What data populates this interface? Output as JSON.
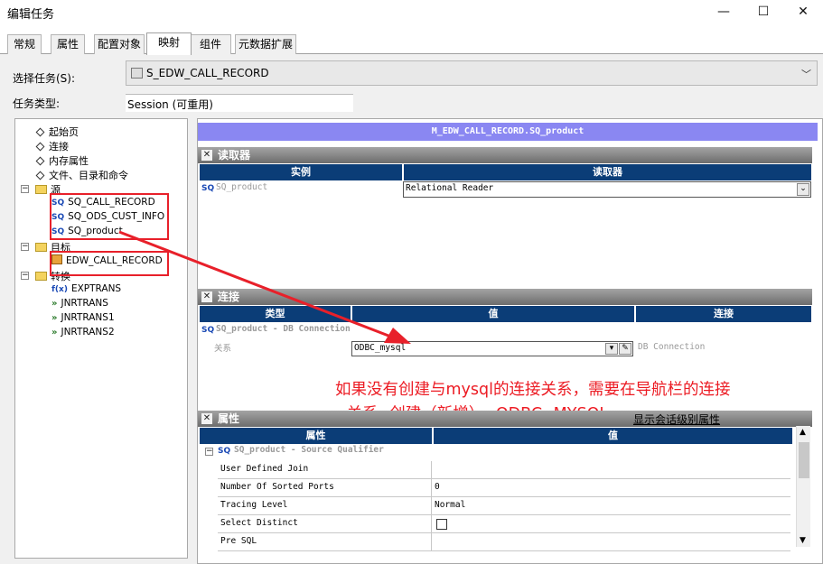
{
  "window": {
    "title": "编辑任务",
    "min": "—",
    "max": "☐",
    "close": "✕"
  },
  "tabs": [
    "常规",
    "属性",
    "配置对象",
    "映射",
    "组件",
    "元数据扩展"
  ],
  "select_task": {
    "label": "选择任务(S):",
    "value": "S_EDW_CALL_RECORD"
  },
  "task_type": {
    "label": "任务类型:",
    "value": "Session (可重用)"
  },
  "tree": {
    "top_items": [
      "起始页",
      "连接",
      "内存属性",
      "文件、目录和命令"
    ],
    "source_label": "源",
    "sources": [
      "SQ_CALL_RECORD",
      "SQ_ODS_CUST_INFO",
      "SQ_product"
    ],
    "target_label": "目标",
    "targets": [
      "EDW_CALL_RECORD"
    ],
    "transform_label": "转换",
    "transforms": [
      "EXPTRANS",
      "JNRTRANS",
      "JNRTRANS1",
      "JNRTRANS2"
    ],
    "sq_icon": "SQ",
    "fx_icon": "f(x)",
    "jn_icon": "»"
  },
  "mapping": {
    "title": "M_EDW_CALL_RECORD.SQ_product",
    "reader": {
      "section": "读取器",
      "col_instance": "实例",
      "col_reader": "读取器",
      "row_instance": "SQ_product",
      "row_reader": "Relational Reader"
    },
    "connection": {
      "section": "连接",
      "col_type": "类型",
      "col_value": "值",
      "col_conn": "连接",
      "group": "SQ_product - DB Connection",
      "row_label": "关系",
      "row_value": "ODBC_mysql",
      "row_conn": "DB Connection"
    },
    "annotation": {
      "line1": "如果没有创建与mysql的连接关系，需要在导航栏的连接",
      "line2": "--关系--创建（新增）--ODBC--MYSQL"
    },
    "properties": {
      "section": "属性",
      "link": "显示会话级别属性",
      "col_attr": "属性",
      "col_value": "值",
      "group": "SQ_product - Source Qualifier",
      "rows": [
        {
          "name": "User Defined Join",
          "value": ""
        },
        {
          "name": "Number Of Sorted Ports",
          "value": "0"
        },
        {
          "name": "Tracing Level",
          "value": "Normal"
        },
        {
          "name": "Select Distinct",
          "value": ""
        },
        {
          "name": "Pre SQL",
          "value": ""
        }
      ]
    }
  }
}
